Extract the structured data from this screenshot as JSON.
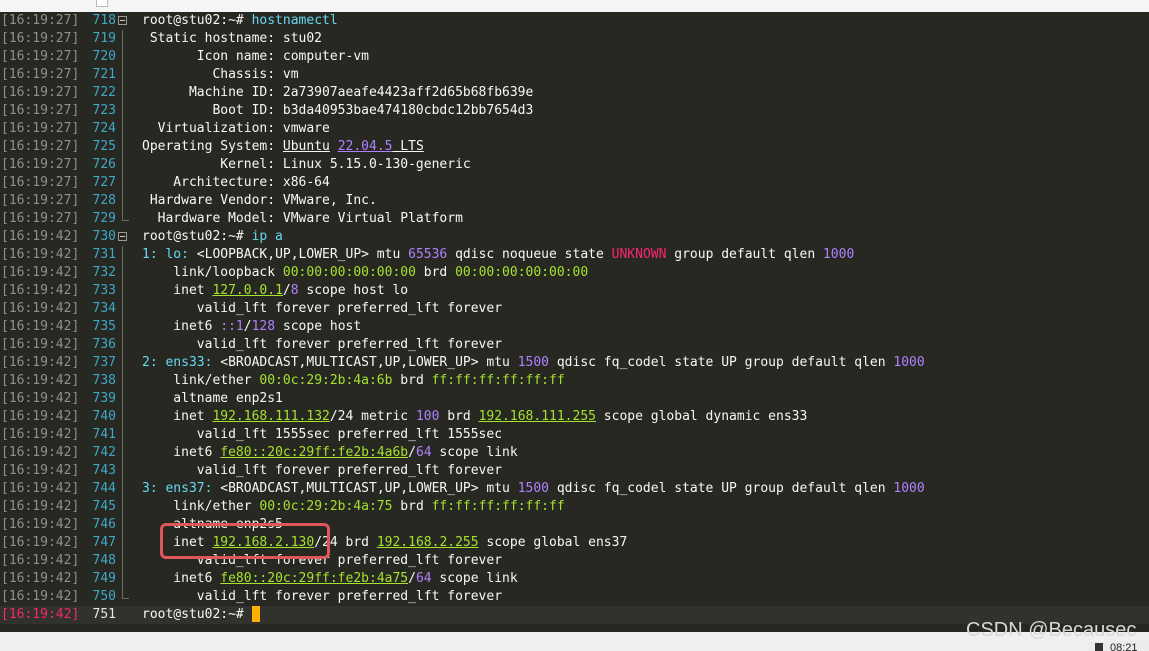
{
  "lines": [
    {
      "ts": "[16:19:27]",
      "ln": "718",
      "fold": "start",
      "segs": [
        {
          "t": "root@stu02:~# "
        },
        {
          "t": "hostnamectl",
          "c": "#66d9ef"
        }
      ]
    },
    {
      "ts": "[16:19:27]",
      "ln": "719",
      "fold": "mid",
      "segs": [
        {
          "t": " Static hostname: stu02"
        }
      ]
    },
    {
      "ts": "[16:19:27]",
      "ln": "720",
      "fold": "mid",
      "segs": [
        {
          "t": "       Icon name: computer-vm"
        }
      ]
    },
    {
      "ts": "[16:19:27]",
      "ln": "721",
      "fold": "mid",
      "segs": [
        {
          "t": "         Chassis: vm"
        }
      ]
    },
    {
      "ts": "[16:19:27]",
      "ln": "722",
      "fold": "mid",
      "segs": [
        {
          "t": "      Machine ID: 2a73907aeafe4423aff2d65b68fb639e"
        }
      ]
    },
    {
      "ts": "[16:19:27]",
      "ln": "723",
      "fold": "mid",
      "segs": [
        {
          "t": "         Boot ID: b3da40953bae474180cbdc12bb7654d3"
        }
      ]
    },
    {
      "ts": "[16:19:27]",
      "ln": "724",
      "fold": "mid",
      "segs": [
        {
          "t": "  Virtualization: vmware"
        }
      ]
    },
    {
      "ts": "[16:19:27]",
      "ln": "725",
      "fold": "mid",
      "segs": [
        {
          "t": "Operating System: "
        },
        {
          "t": "Ubuntu",
          "cls": "u-w"
        },
        {
          "t": " "
        },
        {
          "t": "22.04.5",
          "cls": "u-p"
        },
        {
          "t": " LTS",
          "cls": "u-w"
        }
      ]
    },
    {
      "ts": "[16:19:27]",
      "ln": "726",
      "fold": "mid",
      "segs": [
        {
          "t": "          Kernel: Linux 5.15.0-130-generic"
        }
      ]
    },
    {
      "ts": "[16:19:27]",
      "ln": "727",
      "fold": "mid",
      "segs": [
        {
          "t": "    Architecture: x86-64"
        }
      ]
    },
    {
      "ts": "[16:19:27]",
      "ln": "728",
      "fold": "mid",
      "segs": [
        {
          "t": " Hardware Vendor: VMware, Inc."
        }
      ]
    },
    {
      "ts": "[16:19:27]",
      "ln": "729",
      "fold": "end",
      "segs": [
        {
          "t": "  Hardware Model: VMware Virtual Platform"
        }
      ]
    },
    {
      "ts": "[16:19:42]",
      "ln": "730",
      "fold": "start",
      "segs": [
        {
          "t": "root@stu02:~# "
        },
        {
          "t": "ip a",
          "c": "#66d9ef"
        }
      ]
    },
    {
      "ts": "[16:19:42]",
      "ln": "731",
      "fold": "mid",
      "segs": [
        {
          "t": "1: lo: ",
          "c": "#66d9ef"
        },
        {
          "t": "<LOOPBACK,UP,LOWER_UP>"
        },
        {
          "t": " mtu "
        },
        {
          "t": "65536",
          "cls": "p"
        },
        {
          "t": " qdisc noqueue state "
        },
        {
          "t": "UNKNOWN",
          "cls": "r"
        },
        {
          "t": " group default qlen "
        },
        {
          "t": "1000",
          "cls": "p"
        }
      ]
    },
    {
      "ts": "[16:19:42]",
      "ln": "732",
      "fold": "mid",
      "segs": [
        {
          "t": "    link/loopback "
        },
        {
          "t": "00:00:00:00:00:00",
          "cls": "g"
        },
        {
          "t": " brd "
        },
        {
          "t": "00:00:00:00:00:00",
          "cls": "g"
        }
      ]
    },
    {
      "ts": "[16:19:42]",
      "ln": "733",
      "fold": "mid",
      "segs": [
        {
          "t": "    inet "
        },
        {
          "t": "127.0.0.1",
          "cls": "u"
        },
        {
          "t": "/"
        },
        {
          "t": "8",
          "cls": "p"
        },
        {
          "t": " scope host lo"
        }
      ]
    },
    {
      "ts": "[16:19:42]",
      "ln": "734",
      "fold": "mid",
      "segs": [
        {
          "t": "       valid_lft forever preferred_lft forever"
        }
      ]
    },
    {
      "ts": "[16:19:42]",
      "ln": "735",
      "fold": "mid",
      "segs": [
        {
          "t": "    inet6 "
        },
        {
          "t": "::1",
          "cls": "p"
        },
        {
          "t": "/"
        },
        {
          "t": "128",
          "cls": "p"
        },
        {
          "t": " scope host"
        }
      ]
    },
    {
      "ts": "[16:19:42]",
      "ln": "736",
      "fold": "mid",
      "segs": [
        {
          "t": "       valid_lft forever preferred_lft forever"
        }
      ]
    },
    {
      "ts": "[16:19:42]",
      "ln": "737",
      "fold": "mid",
      "segs": [
        {
          "t": "2: ens33: ",
          "c": "#66d9ef"
        },
        {
          "t": "<BROADCAST,MULTICAST,UP,LOWER_UP>"
        },
        {
          "t": " mtu "
        },
        {
          "t": "1500",
          "cls": "p"
        },
        {
          "t": " qdisc fq_codel state UP group default qlen "
        },
        {
          "t": "1000",
          "cls": "p"
        }
      ]
    },
    {
      "ts": "[16:19:42]",
      "ln": "738",
      "fold": "mid",
      "segs": [
        {
          "t": "    link/ether "
        },
        {
          "t": "00:0c:29:2b:4a:6b",
          "cls": "g"
        },
        {
          "t": " brd "
        },
        {
          "t": "ff:ff:ff:ff:ff:ff",
          "cls": "g"
        }
      ]
    },
    {
      "ts": "[16:19:42]",
      "ln": "739",
      "fold": "mid",
      "segs": [
        {
          "t": "    altname enp2s1"
        }
      ]
    },
    {
      "ts": "[16:19:42]",
      "ln": "740",
      "fold": "mid",
      "segs": [
        {
          "t": "    inet "
        },
        {
          "t": "192.168.111.132",
          "cls": "u"
        },
        {
          "t": "/24 metric "
        },
        {
          "t": "100",
          "cls": "p"
        },
        {
          "t": " brd "
        },
        {
          "t": "192.168.111.255",
          "cls": "u"
        },
        {
          "t": " scope global dynamic ens33"
        }
      ]
    },
    {
      "ts": "[16:19:42]",
      "ln": "741",
      "fold": "mid",
      "segs": [
        {
          "t": "       valid_lft 1555sec preferred_lft 1555sec"
        }
      ]
    },
    {
      "ts": "[16:19:42]",
      "ln": "742",
      "fold": "mid",
      "segs": [
        {
          "t": "    inet6 "
        },
        {
          "t": "fe80::20c:29ff:fe2b:4a6b",
          "cls": "u"
        },
        {
          "t": "/"
        },
        {
          "t": "64",
          "cls": "p"
        },
        {
          "t": " scope link"
        }
      ]
    },
    {
      "ts": "[16:19:42]",
      "ln": "743",
      "fold": "mid",
      "segs": [
        {
          "t": "       valid_lft forever preferred_lft forever"
        }
      ]
    },
    {
      "ts": "[16:19:42]",
      "ln": "744",
      "fold": "mid",
      "segs": [
        {
          "t": "3: ens37: ",
          "c": "#66d9ef"
        },
        {
          "t": "<BROADCAST,MULTICAST,UP,LOWER_UP>"
        },
        {
          "t": " mtu "
        },
        {
          "t": "1500",
          "cls": "p"
        },
        {
          "t": " qdisc fq_codel state UP group default qlen "
        },
        {
          "t": "1000",
          "cls": "p"
        }
      ]
    },
    {
      "ts": "[16:19:42]",
      "ln": "745",
      "fold": "mid",
      "segs": [
        {
          "t": "    link/ether "
        },
        {
          "t": "00:0c:29:2b:4a:75",
          "cls": "g"
        },
        {
          "t": " brd "
        },
        {
          "t": "ff:ff:ff:ff:ff:ff",
          "cls": "g"
        }
      ]
    },
    {
      "ts": "[16:19:42]",
      "ln": "746",
      "fold": "mid",
      "segs": [
        {
          "t": "    altname enp2s5"
        }
      ]
    },
    {
      "ts": "[16:19:42]",
      "ln": "747",
      "fold": "mid",
      "segs": [
        {
          "t": "    inet "
        },
        {
          "t": "192.168.2.130",
          "cls": "u"
        },
        {
          "t": "/24 brd "
        },
        {
          "t": "192.168.2.255",
          "cls": "u"
        },
        {
          "t": " scope global ens37"
        }
      ]
    },
    {
      "ts": "[16:19:42]",
      "ln": "748",
      "fold": "mid",
      "segs": [
        {
          "t": "       valid_lft forever preferred_lft forever"
        }
      ]
    },
    {
      "ts": "[16:19:42]",
      "ln": "749",
      "fold": "mid",
      "segs": [
        {
          "t": "    inet6 "
        },
        {
          "t": "fe80::20c:29ff:fe2b:4a75",
          "cls": "u"
        },
        {
          "t": "/"
        },
        {
          "t": "64",
          "cls": "p"
        },
        {
          "t": " scope link"
        }
      ]
    },
    {
      "ts": "[16:19:42]",
      "ln": "750",
      "fold": "end",
      "segs": [
        {
          "t": "       valid_lft forever preferred_lft forever"
        }
      ]
    },
    {
      "ts": "[16:19:42]",
      "ln": "751",
      "fold": "none",
      "current": true,
      "segs": [
        {
          "t": "root@stu02:~# "
        }
      ]
    }
  ],
  "watermark": "CSDN @Becausec",
  "clock": "08:21",
  "colors": {
    "bg": "#272822",
    "prompt_cmd": "#66d9ef",
    "number": "#ae81ff",
    "warn": "#f92672",
    "addr": "#a6e22e",
    "highlight_box": "#e0575b",
    "cursor": "#ffb000"
  }
}
